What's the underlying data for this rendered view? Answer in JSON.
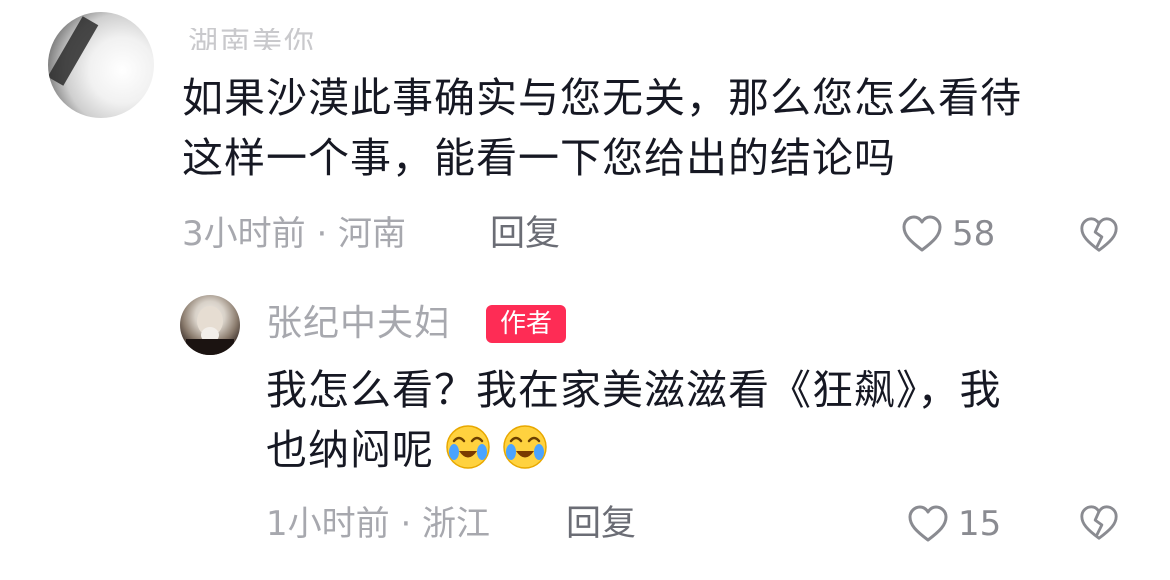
{
  "comment": {
    "username": "湖南美你",
    "text_line1": "如果沙漠此事确实与您无关，那么您怎么看待",
    "text_line2": "这样一个事，能看一下您给出的结论吗",
    "time_location": "3小时前 · 河南",
    "reply_label": "回复",
    "like_count": "58"
  },
  "reply": {
    "username": "张纪中夫妇",
    "badge": "作者",
    "text_line1": "我怎么看？我在家美滋滋看《狂飙》，我",
    "text_line2": "也纳闷呢",
    "emojis": [
      "crying-laughing-emoji",
      "crying-laughing-emoji"
    ],
    "time_location": "1小时前 · 浙江",
    "reply_label": "回复",
    "like_count": "15"
  },
  "icons": {
    "like": "heart-outline-icon",
    "dislike": "broken-heart-icon"
  },
  "colors": {
    "badge": "#fe2c55",
    "text": "#161823",
    "meta": "#a7a8ae"
  }
}
